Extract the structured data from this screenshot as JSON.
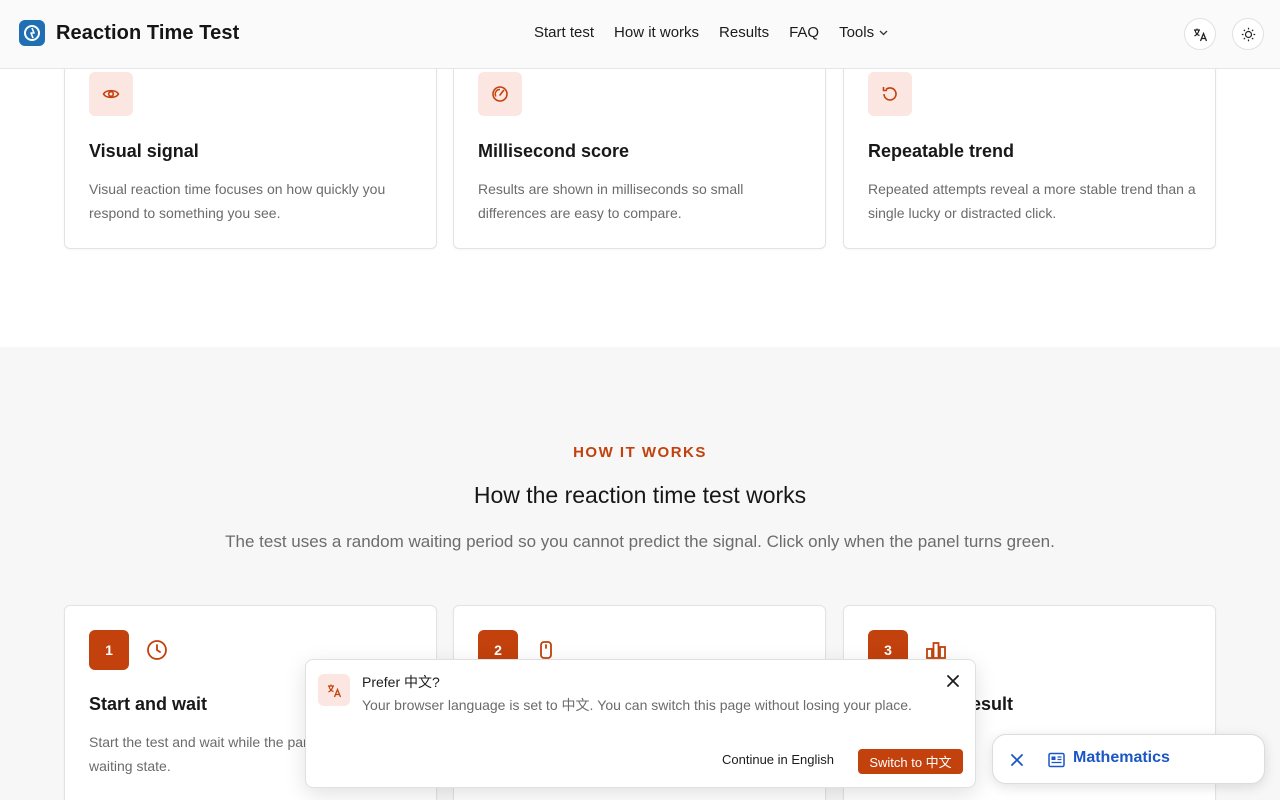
{
  "header": {
    "title": "Reaction Time Test",
    "nav": [
      "Start test",
      "How it works",
      "Results",
      "FAQ",
      "Tools"
    ]
  },
  "features": [
    {
      "icon": "eye-icon",
      "title": "Visual signal",
      "text": "Visual reaction time focuses on how quickly you respond to something you see."
    },
    {
      "icon": "gauge-icon",
      "title": "Millisecond score",
      "text": "Results are shown in milliseconds so small differences are easy to compare."
    },
    {
      "icon": "refresh-icon",
      "title": "Repeatable trend",
      "text": "Repeated attempts reveal a more stable trend than a single lucky or distracted click."
    }
  ],
  "how_it_works": {
    "eyebrow": "HOW IT WORKS",
    "title": "How the reaction time test works",
    "subtitle": "The test uses a random waiting period so you cannot predict the signal. Click only when the panel turns green.",
    "steps": [
      {
        "number": "1",
        "icon": "clock-icon",
        "title": "Start and wait",
        "text": "Start the test and wait while the panel shows the waiting state."
      },
      {
        "number": "2",
        "icon": "mouse-icon",
        "title": "",
        "text": ""
      },
      {
        "number": "3",
        "icon": "bar-chart-icon",
        "title": "result",
        "text": ""
      }
    ]
  },
  "language_prompt": {
    "title": "Prefer 中文?",
    "body": "Your browser language is set to 中文. You can switch this page without losing your place.",
    "continue_label": "Continue in English",
    "switch_label": "Switch to 中文"
  },
  "floating_chip": {
    "label": "Mathematics"
  },
  "colors": {
    "accent": "#c2410c",
    "accent_soft": "#fbe6e1",
    "brand_logo": "#1f6fb2",
    "chip_text": "#1a56c4"
  }
}
